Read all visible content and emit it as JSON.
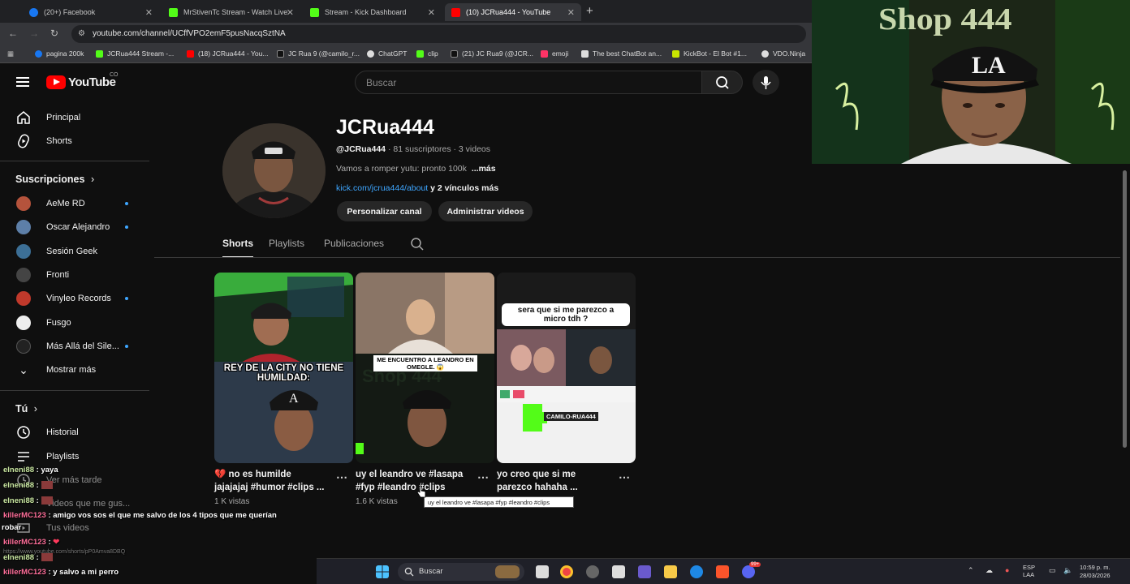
{
  "browser": {
    "tabs": [
      {
        "label": "(20+) Facebook",
        "icon": "facebook-icon",
        "color": "#1877f2"
      },
      {
        "label": "MrStivenTc Stream - Watch Live",
        "icon": "kick-icon",
        "color": "#53fc18"
      },
      {
        "label": "Stream - Kick Dashboard",
        "icon": "kick-icon",
        "color": "#53fc18"
      },
      {
        "label": "(10) JCRua444 - YouTube",
        "icon": "youtube-icon",
        "color": "#ff0000"
      }
    ],
    "url": "youtube.com/channel/UCffVPO2emF5pusNacqSztNA",
    "bookmarks": [
      {
        "label": "pagina 200k",
        "color": "#1877f2"
      },
      {
        "label": "JCRua444 Stream -...",
        "color": "#53fc18"
      },
      {
        "label": "(18) JCRua444 - You...",
        "color": "#ff0000"
      },
      {
        "label": "JC Rua 9 (@camilo_r...",
        "color": "#222"
      },
      {
        "label": "ChatGPT",
        "color": "#ddd"
      },
      {
        "label": "clip",
        "color": "#53fc18"
      },
      {
        "label": "(21) JC Rua9 (@JCR...",
        "color": "#111"
      },
      {
        "label": "emoji",
        "color": "#ff3366"
      },
      {
        "label": "The best ChatBot an...",
        "color": "#ddd"
      },
      {
        "label": "KickBot - El Bot #1...",
        "color": "#c8e600"
      },
      {
        "label": "VDO.Ninja",
        "color": "#ddd"
      }
    ]
  },
  "youtube": {
    "logo_text": "YouTube",
    "region": "CO",
    "search_placeholder": "Buscar"
  },
  "sidebar": {
    "main": [
      {
        "label": "Principal",
        "icon": "home-icon"
      },
      {
        "label": "Shorts",
        "icon": "shorts-icon"
      }
    ],
    "subscriptions_title": "Suscripciones",
    "subscriptions": [
      {
        "label": "AeMe RD",
        "dot": true,
        "color": "#b5533c"
      },
      {
        "label": "Oscar Alejandro",
        "dot": true,
        "color": "#5d7fa8"
      },
      {
        "label": "Sesión Geek",
        "dot": false,
        "color": "#3c6f96"
      },
      {
        "label": "Fronti",
        "dot": false,
        "color": "#444"
      },
      {
        "label": "Vinyleo Records",
        "dot": true,
        "color": "#c0392b"
      },
      {
        "label": "Fusgo",
        "dot": false,
        "color": "#eee"
      },
      {
        "label": "Más Allá del Sile...",
        "dot": true,
        "color": "#222"
      }
    ],
    "show_more": "Mostrar más",
    "you_title": "Tú",
    "you_items": [
      {
        "label": "Historial",
        "icon": "history-icon"
      },
      {
        "label": "Playlists",
        "icon": "playlists-icon"
      },
      {
        "label": "Ver más tarde",
        "icon": "watch-later-icon"
      },
      {
        "label": "Videos que me gus...",
        "icon": "like-icon"
      },
      {
        "label": "Tus videos",
        "icon": "your-videos-icon"
      }
    ]
  },
  "channel": {
    "name": "JCRua444",
    "handle": "@JCRua444",
    "subscribers": "· 81 suscriptores · 3 videos",
    "description": "Vamos a romper yutu: pronto 100k",
    "more": "...más",
    "link": "kick.com/jcrua444/about",
    "more_links": "y 2 vínculos más",
    "buttons": [
      "Personalizar canal",
      "Administrar videos"
    ],
    "tabs": [
      "Shorts",
      "Playlists",
      "Publicaciones"
    ]
  },
  "shorts": [
    {
      "title_line1": "💔 no es humilde",
      "title_line2": "jajajajaj #humor #clips ...",
      "views": "1 K vistas",
      "overlay": "REY DE LA CITY NO TIENE HUMILDAD:"
    },
    {
      "title_line1": "uy el leandro ve #lasapa",
      "title_line2": "#fyp #leandro #clips",
      "views": "1.6 K vistas",
      "overlay": "ME ENCUENTRO A LEANDRO EN OMEGLE. 😱"
    },
    {
      "title_line1": "yo creo que si me",
      "title_line2": "parezco hahaha ...",
      "views": "",
      "overlay": "sera que si me parezco a micro tdh ?",
      "overlay2": "CAMILO-RUA444"
    }
  ],
  "tooltip": "uy el leandro ve #lasapa #fyp #leandro #clips",
  "chat": [
    {
      "user": "elneni88",
      "msg": ": yaya"
    },
    {
      "user": "elneni88",
      "msg": ":"
    },
    {
      "user": "elneni88",
      "msg": ":"
    },
    {
      "user": "killerMC123",
      "msg": ": amigo vos sos el que me salvo de los 4 tipos que me querían"
    },
    {
      "user": "",
      "msg": "robar"
    },
    {
      "user": "killerMC123",
      "msg": ":"
    },
    {
      "user": "",
      "msg": "https://www.youtube.com/shorts/pP0Amva8DBQ"
    },
    {
      "user": "elneni88",
      "msg": ":"
    },
    {
      "user": "killerMC123",
      "msg": ": y salvo a mi perro"
    }
  ],
  "taskbar": {
    "search": "Buscar",
    "lang1": "ESP",
    "lang2": "LAA",
    "time": "10:59 p. m.",
    "date": "28/03/2026",
    "badge": "99+"
  },
  "webcam": {
    "sign_text": "Shop 444",
    "cap_text": "LA"
  }
}
